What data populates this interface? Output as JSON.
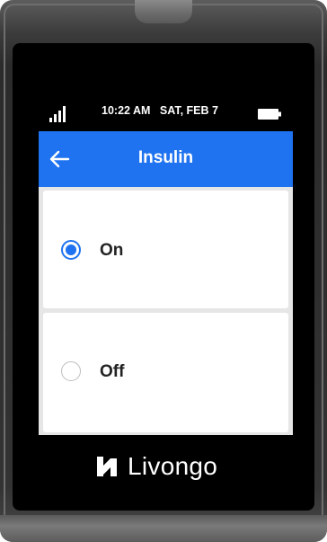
{
  "status_bar": {
    "time": "10:22 AM",
    "date": "SAT, FEB 7",
    "signal_icon": "signal-bars-icon",
    "battery_icon": "battery-full-icon"
  },
  "header": {
    "title": "Insulin",
    "back_icon": "arrow-left-icon",
    "background_color": "#1f73f0"
  },
  "options": [
    {
      "label": "On",
      "selected": true
    },
    {
      "label": "Off",
      "selected": false
    }
  ],
  "brand": {
    "name": "Livongo",
    "logo_icon": "livongo-logo-icon"
  }
}
